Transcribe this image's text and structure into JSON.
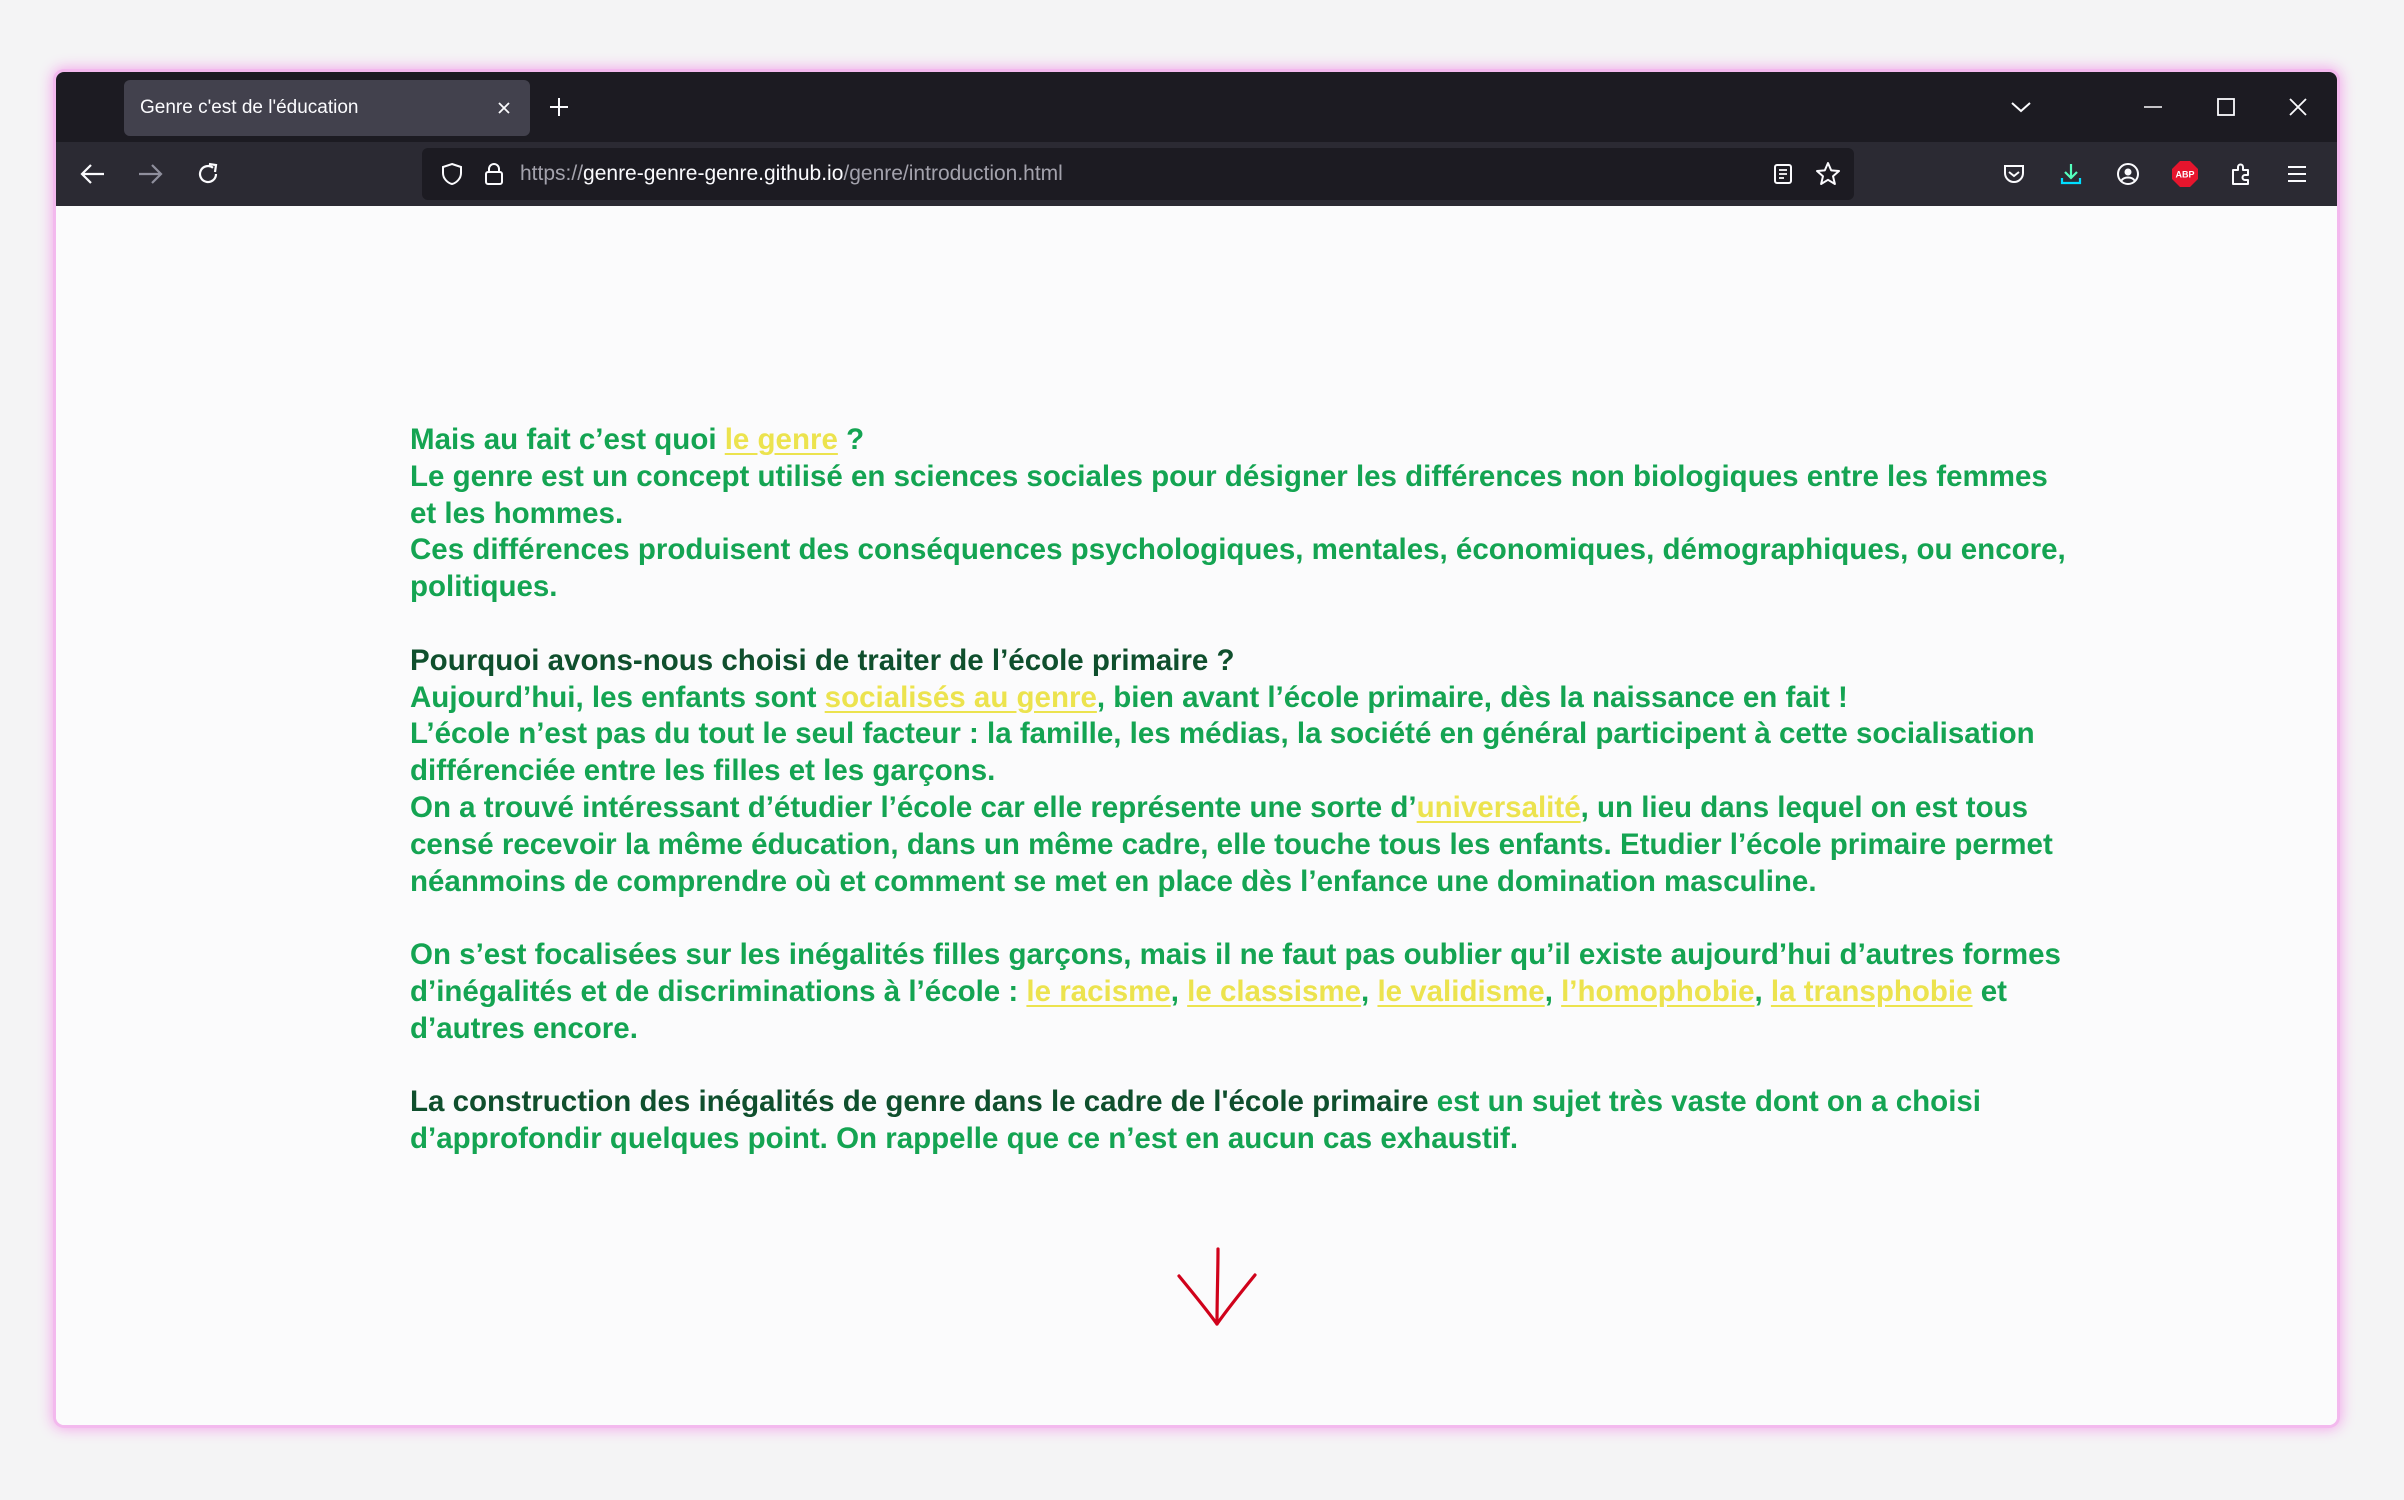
{
  "browser": {
    "tab": {
      "title": "Genre c'est de l'éducation"
    },
    "url": {
      "scheme": "https://",
      "host": "genre-genre-genre.github.io",
      "path": "/genre/introduction.html"
    },
    "icons": [
      "back-icon",
      "forward-icon",
      "reload-icon",
      "shield-icon",
      "lock-icon",
      "reader-view-icon",
      "bookmark-star-icon",
      "pocket-icon",
      "download-icon",
      "account-icon",
      "adblock-icon",
      "extensions-icon",
      "menu-icon"
    ],
    "adblock_label": "ABP"
  },
  "colors": {
    "text_green": "#14a452",
    "text_dark": "#0f4f2d",
    "link_yellow": "#ece34e",
    "arrow_red": "#d0021b"
  },
  "article": {
    "p1": {
      "a": "Mais au fait c’est quoi ",
      "link": "le genre",
      "b": " ?",
      "line2": "Le genre est un concept utilisé en sciences sociales pour désigner les différences non biologiques entre les femmes et les hommes.",
      "line3": "Ces différences produisent des conséquences psychologiques, mentales, économiques, démographiques, ou encore, politiques."
    },
    "p2": {
      "heading": "Pourquoi avons-nous choisi de traiter de l’école primaire ?",
      "l1a": "Aujourd’hui, les enfants sont ",
      "l1link": "socialisés au genre",
      "l1b": ", bien avant l’école primaire, dès la naissance en fait !",
      "l2": "L’école n’est pas du tout le seul facteur : la famille, les médias, la société en général participent à cette socialisation différenciée entre les filles et les garçons.",
      "l3a": "On a trouvé intéressant d’étudier l’école car elle représente une sorte d’",
      "l3link": "universalité",
      "l3b": ", un lieu dans lequel on est tous censé recevoir la même éducation, dans un même cadre, elle touche tous les enfants. Etudier l’école primaire permet néanmoins de comprendre où et comment se met en place dès l’enfance une domination masculine."
    },
    "p3": {
      "a": "On s’est focalisées sur les inégalités filles garçons, mais il ne faut pas oublier qu’il existe aujourd’hui d’autres formes d’inégalités et de discriminations à l’école : ",
      "links": [
        "le racisme",
        "le classisme",
        "le validisme",
        "l’homophobie",
        "la transphobie"
      ],
      "sep": ", ",
      "b": " et d’autres encore."
    },
    "p4": {
      "dark": "La construction des inégalités de genre dans le cadre de l'école primaire",
      "rest": " est un sujet très vaste dont on a choisi d’approfondir quelques point. On rappelle que ce n’est en aucun cas exhaustif."
    }
  }
}
